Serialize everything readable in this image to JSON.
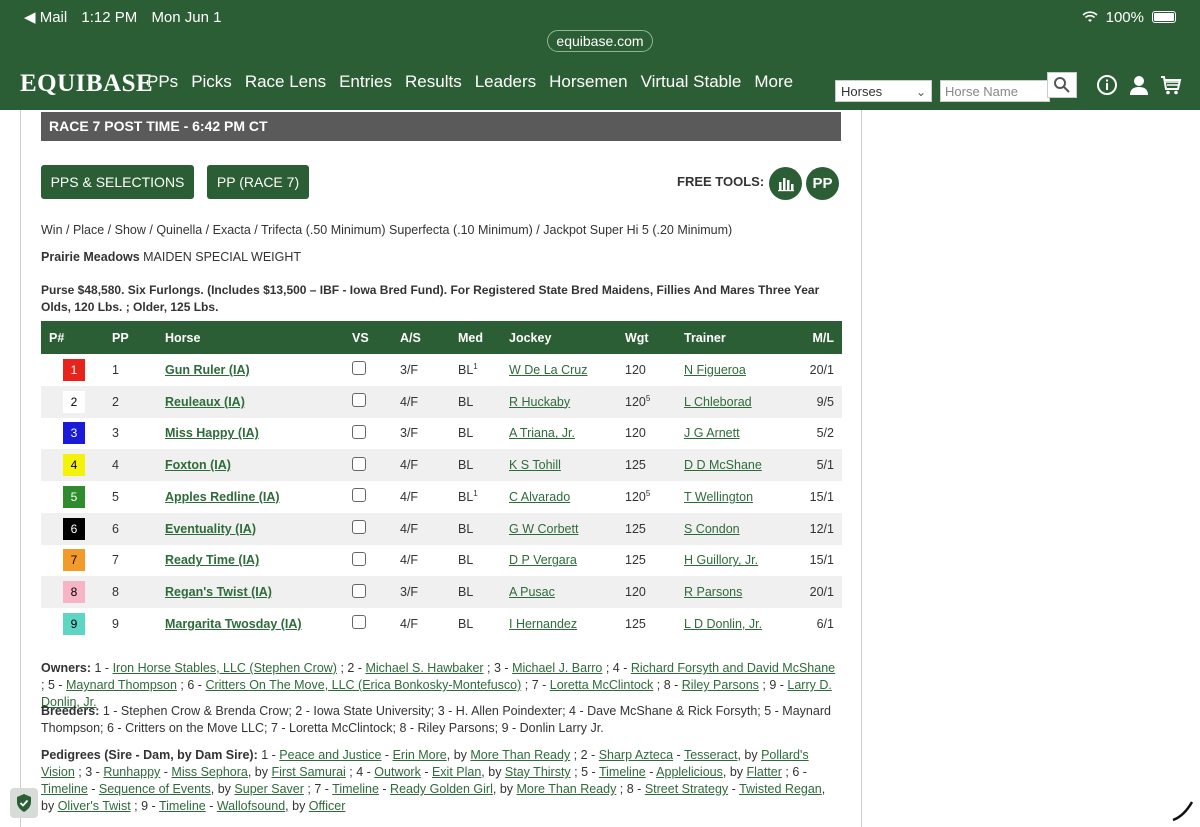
{
  "status_bar": {
    "back_app": "◀ Mail",
    "time": "1:12 PM",
    "date": "Mon Jun 1",
    "battery": "100%"
  },
  "browser": {
    "url": "equibase.com"
  },
  "header": {
    "logo": "EQUIBASE",
    "nav": [
      "PPs",
      "Picks",
      "Race Lens",
      "Entries",
      "Results",
      "Leaders",
      "Horsemen",
      "Virtual Stable",
      "More"
    ],
    "search_type": "Horses",
    "search_placeholder": "Horse Name",
    "icons": [
      "search-icon",
      "info-icon",
      "user-icon",
      "cart-icon"
    ]
  },
  "race": {
    "post_time_label": "RACE 7 POST TIME - 6:42 PM CT",
    "buttons": {
      "pps_selections": "PPS & SELECTIONS",
      "pp_race": "PP (RACE 7)"
    },
    "free_tools_label": "FREE TOOLS:",
    "pp_tool": "PP",
    "wagers": "Win / Place / Show / Quinella / Exacta / Trifecta (.50 Minimum) Superfecta (.10 Minimum) / Jackpot Super Hi 5 (.20 Minimum)",
    "track": "Prairie Meadows",
    "race_type": "MAIDEN SPECIAL WEIGHT",
    "purse": "Purse $48,580. Six Furlongs. (Includes $13,500 – IBF - Iowa Bred Fund). For Registered State Bred Maidens, Fillies And Mares Three Year Olds, 120 Lbs. ; Older, 125 Lbs."
  },
  "table": {
    "columns": [
      "P#",
      "PP",
      "Horse",
      "VS",
      "A/S",
      "Med",
      "Jockey",
      "Wgt",
      "Trainer",
      "M/L"
    ],
    "rows": [
      {
        "pnum": "1",
        "pp": "1",
        "horse": "Gun Ruler (IA)",
        "as": "3/F",
        "med": "BL",
        "med_sup": "1",
        "jockey": "W De La Cruz",
        "wgt": "120",
        "wgt_sup": "",
        "trainer": "N Figueroa",
        "ml": "20/1",
        "saddle_bg": "#e8231c",
        "saddle_fg": "#ffffff"
      },
      {
        "pnum": "2",
        "pp": "2",
        "horse": "Reuleaux (IA)",
        "as": "4/F",
        "med": "BL",
        "med_sup": "",
        "jockey": "R Huckaby",
        "wgt": "120",
        "wgt_sup": "5",
        "trainer": "L Chleborad",
        "ml": "9/5",
        "saddle_bg": "#ffffff",
        "saddle_fg": "#000000"
      },
      {
        "pnum": "3",
        "pp": "3",
        "horse": "Miss Happy (IA)",
        "as": "3/F",
        "med": "BL",
        "med_sup": "",
        "jockey": "A Triana, Jr.",
        "wgt": "120",
        "wgt_sup": "",
        "trainer": "J G Arnett",
        "ml": "5/2",
        "saddle_bg": "#1a1adb",
        "saddle_fg": "#ffffff"
      },
      {
        "pnum": "4",
        "pp": "4",
        "horse": "Foxton (IA)",
        "as": "4/F",
        "med": "BL",
        "med_sup": "",
        "jockey": "K S Tohill",
        "wgt": "125",
        "wgt_sup": "",
        "trainer": "D D McShane",
        "ml": "5/1",
        "saddle_bg": "#f5f20a",
        "saddle_fg": "#000000"
      },
      {
        "pnum": "5",
        "pp": "5",
        "horse": "Apples Redline (IA)",
        "as": "4/F",
        "med": "BL",
        "med_sup": "1",
        "jockey": "C Alvarado",
        "wgt": "120",
        "wgt_sup": "5",
        "trainer": "T Wellington",
        "ml": "15/1",
        "saddle_bg": "#2e8b2e",
        "saddle_fg": "#ffffff"
      },
      {
        "pnum": "6",
        "pp": "6",
        "horse": "Eventuality (IA)",
        "as": "4/F",
        "med": "BL",
        "med_sup": "",
        "jockey": "G W Corbett",
        "wgt": "125",
        "wgt_sup": "",
        "trainer": "S Condon",
        "ml": "12/1",
        "saddle_bg": "#000000",
        "saddle_fg": "#ffffff"
      },
      {
        "pnum": "7",
        "pp": "7",
        "horse": "Ready Time (IA)",
        "as": "4/F",
        "med": "BL",
        "med_sup": "",
        "jockey": "D P Vergara",
        "wgt": "125",
        "wgt_sup": "",
        "trainer": "H Guillory, Jr.",
        "ml": "15/1",
        "saddle_bg": "#f39a2b",
        "saddle_fg": "#000000"
      },
      {
        "pnum": "8",
        "pp": "8",
        "horse": "Regan's Twist (IA)",
        "as": "3/F",
        "med": "BL",
        "med_sup": "",
        "jockey": "A Pusac",
        "wgt": "120",
        "wgt_sup": "",
        "trainer": "R Parsons",
        "ml": "20/1",
        "saddle_bg": "#f7b5c3",
        "saddle_fg": "#000000"
      },
      {
        "pnum": "9",
        "pp": "9",
        "horse": "Margarita Twosday (IA)",
        "as": "4/F",
        "med": "BL",
        "med_sup": "",
        "jockey": "I Hernandez",
        "wgt": "125",
        "wgt_sup": "",
        "trainer": "L D Donlin, Jr.",
        "ml": "6/1",
        "saddle_bg": "#5fd6c4",
        "saddle_fg": "#000000"
      }
    ]
  },
  "owners": {
    "label": "Owners:",
    "entries": [
      {
        "num": "1",
        "name": "Iron Horse Stables, LLC (Stephen Crow)"
      },
      {
        "num": "2",
        "name": "Michael S. Hawbaker"
      },
      {
        "num": "3",
        "name": "Michael J. Barro"
      },
      {
        "num": "4",
        "name": "Richard Forsyth and David McShane"
      },
      {
        "num": "5",
        "name": "Maynard Thompson"
      },
      {
        "num": "6",
        "name": "Critters On The Move, LLC (Erica Bonkosky-Montefusco)"
      },
      {
        "num": "7",
        "name": "Loretta McClintock"
      },
      {
        "num": "8",
        "name": "Riley Parsons"
      },
      {
        "num": "9",
        "name": "Larry D. Donlin, Jr."
      }
    ]
  },
  "breeders": {
    "label": "Breeders:",
    "text": "1 - Stephen Crow & Brenda Crow; 2 - Iowa State University; 3 - H. Allen Poindexter; 4 - Dave McShane & Rick Forsyth; 5 - Maynard Thompson; 6 - Critters on the Move LLC; 7 - Loretta McClintock; 8 - Riley Parsons; 9 - Donlin Larry Jr."
  },
  "pedigrees": {
    "label": "Pedigrees (Sire - Dam, by Dam Sire):",
    "entries": [
      {
        "num": "1",
        "sire": "Peace and Justice",
        "dam": "Erin More",
        "damsire": "More Than Ready"
      },
      {
        "num": "2",
        "sire": "Sharp Azteca",
        "dam": "Tesseract",
        "damsire": "Pollard's Vision"
      },
      {
        "num": "3",
        "sire": "Runhappy",
        "dam": "Miss Sephora",
        "damsire": "First Samurai"
      },
      {
        "num": "4",
        "sire": "Outwork",
        "dam": "Exit Plan",
        "damsire": "Stay Thirsty"
      },
      {
        "num": "5",
        "sire": "Timeline",
        "dam": "Applelicious",
        "damsire": "Flatter"
      },
      {
        "num": "6",
        "sire": "Timeline",
        "dam": "Sequence of Events",
        "damsire": "Super Saver"
      },
      {
        "num": "7",
        "sire": "Timeline",
        "dam": "Ready Golden Girl",
        "damsire": "More Than Ready"
      },
      {
        "num": "8",
        "sire": "Street Strategy",
        "dam": "Twisted Regan",
        "damsire": "Oliver's Twist"
      },
      {
        "num": "9",
        "sire": "Timeline",
        "dam": "Wallofsound",
        "damsire": "Officer"
      }
    ]
  }
}
